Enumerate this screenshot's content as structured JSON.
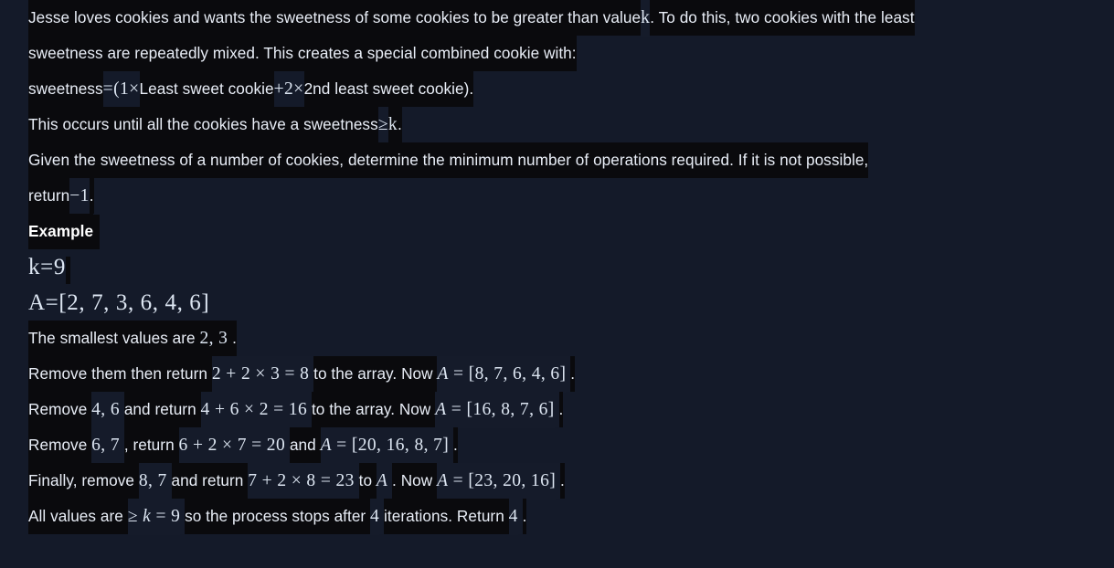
{
  "page": {
    "background": "#141a29",
    "highlight": "#0a0a0d",
    "highlight_alt": "#151b2a",
    "text_color": "#e9eef7",
    "math_color": "#dde6f2"
  },
  "intro": {
    "line1_a": "Jesse loves cookies and wants the sweetness of some cookies to be greater than value",
    "line1_k": "k",
    "line1_b": ". To do this, two cookies with the least",
    "line2": "sweetness are repeatedly mixed. This creates a special combined cookie with:"
  },
  "formula": {
    "label": "sweetness",
    "eq": "=",
    "open_paren": "(",
    "one": "1",
    "times1": "×",
    "term1": "Least sweet cookie",
    "plus": "+",
    "two": "2",
    "times2": "×",
    "term2": "2nd least sweet cookie)."
  },
  "condition": {
    "text_a": "This occurs until all the cookies have a sweetness",
    "ge": "≥",
    "k": "k",
    "period": "."
  },
  "task": {
    "line1": "Given the sweetness of a number of cookies, determine the minimum number of operations required. If it is not possible,",
    "line2_a": "return",
    "line2_val": "−1",
    "line2_b": "."
  },
  "example": {
    "heading": "Example",
    "k_assign": {
      "var": "k",
      "eq": "=",
      "value": "9"
    },
    "a_assign": {
      "var": "A",
      "eq": "=",
      "value": "[2, 7, 3, 6, 4, 6]"
    }
  },
  "steps": [
    {
      "id": "step-smallest",
      "parts": [
        {
          "kind": "text",
          "value": "The smallest values are",
          "bg": "dark"
        },
        {
          "kind": "math",
          "value": "2, 3",
          "bg": "dark"
        },
        {
          "kind": "text",
          "value": ".",
          "bg": "dark"
        }
      ]
    },
    {
      "id": "step-1",
      "parts": [
        {
          "kind": "text",
          "value": "Remove them then return",
          "bg": "dark"
        },
        {
          "kind": "math",
          "value": "2 + 2 × 3 = 8",
          "bg": "alt"
        },
        {
          "kind": "text",
          "value": "to the array. Now",
          "bg": "dark"
        },
        {
          "kind": "math",
          "value": "A = [8, 7, 6, 4, 6]",
          "bg": "alt"
        },
        {
          "kind": "text",
          "value": ".",
          "bg": "dark"
        }
      ]
    },
    {
      "id": "step-2",
      "parts": [
        {
          "kind": "text",
          "value": "Remove",
          "bg": "dark"
        },
        {
          "kind": "math",
          "value": "4, 6",
          "bg": "alt"
        },
        {
          "kind": "text",
          "value": "and return",
          "bg": "dark"
        },
        {
          "kind": "math",
          "value": "4 + 6 × 2 = 16",
          "bg": "alt"
        },
        {
          "kind": "text",
          "value": "to the array. Now",
          "bg": "dark"
        },
        {
          "kind": "math",
          "value": "A = [16, 8, 7, 6]",
          "bg": "alt"
        },
        {
          "kind": "text",
          "value": ".",
          "bg": "dark"
        }
      ]
    },
    {
      "id": "step-3",
      "parts": [
        {
          "kind": "text",
          "value": "Remove",
          "bg": "dark"
        },
        {
          "kind": "math",
          "value": "6, 7",
          "bg": "alt"
        },
        {
          "kind": "text",
          "value": ", return",
          "bg": "dark"
        },
        {
          "kind": "math",
          "value": "6 + 2 × 7 = 20",
          "bg": "alt"
        },
        {
          "kind": "text",
          "value": "and",
          "bg": "dark"
        },
        {
          "kind": "math",
          "value": "A = [20, 16, 8, 7]",
          "bg": "alt"
        },
        {
          "kind": "text",
          "value": ".",
          "bg": "dark"
        }
      ]
    },
    {
      "id": "step-4",
      "parts": [
        {
          "kind": "text",
          "value": "Finally, remove",
          "bg": "dark"
        },
        {
          "kind": "math",
          "value": "8, 7",
          "bg": "alt"
        },
        {
          "kind": "text",
          "value": "and return",
          "bg": "dark"
        },
        {
          "kind": "math",
          "value": "7 + 2 × 8 = 23",
          "bg": "alt"
        },
        {
          "kind": "text",
          "value": "to",
          "bg": "dark"
        },
        {
          "kind": "math",
          "value": "A",
          "bg": "alt"
        },
        {
          "kind": "text",
          "value": ". Now",
          "bg": "dark"
        },
        {
          "kind": "math",
          "value": "A = [23, 20, 16]",
          "bg": "alt"
        },
        {
          "kind": "text",
          "value": ".",
          "bg": "dark"
        }
      ]
    },
    {
      "id": "step-conclusion",
      "parts": [
        {
          "kind": "text",
          "value": "All values are",
          "bg": "dark"
        },
        {
          "kind": "math",
          "value": "≥ k = 9",
          "bg": "alt"
        },
        {
          "kind": "text",
          "value": "so the process stops after",
          "bg": "dark"
        },
        {
          "kind": "math",
          "value": "4",
          "bg": "alt"
        },
        {
          "kind": "text",
          "value": "iterations. Return",
          "bg": "dark"
        },
        {
          "kind": "math",
          "value": "4",
          "bg": "alt"
        },
        {
          "kind": "text",
          "value": ".",
          "bg": "dark"
        }
      ]
    }
  ]
}
